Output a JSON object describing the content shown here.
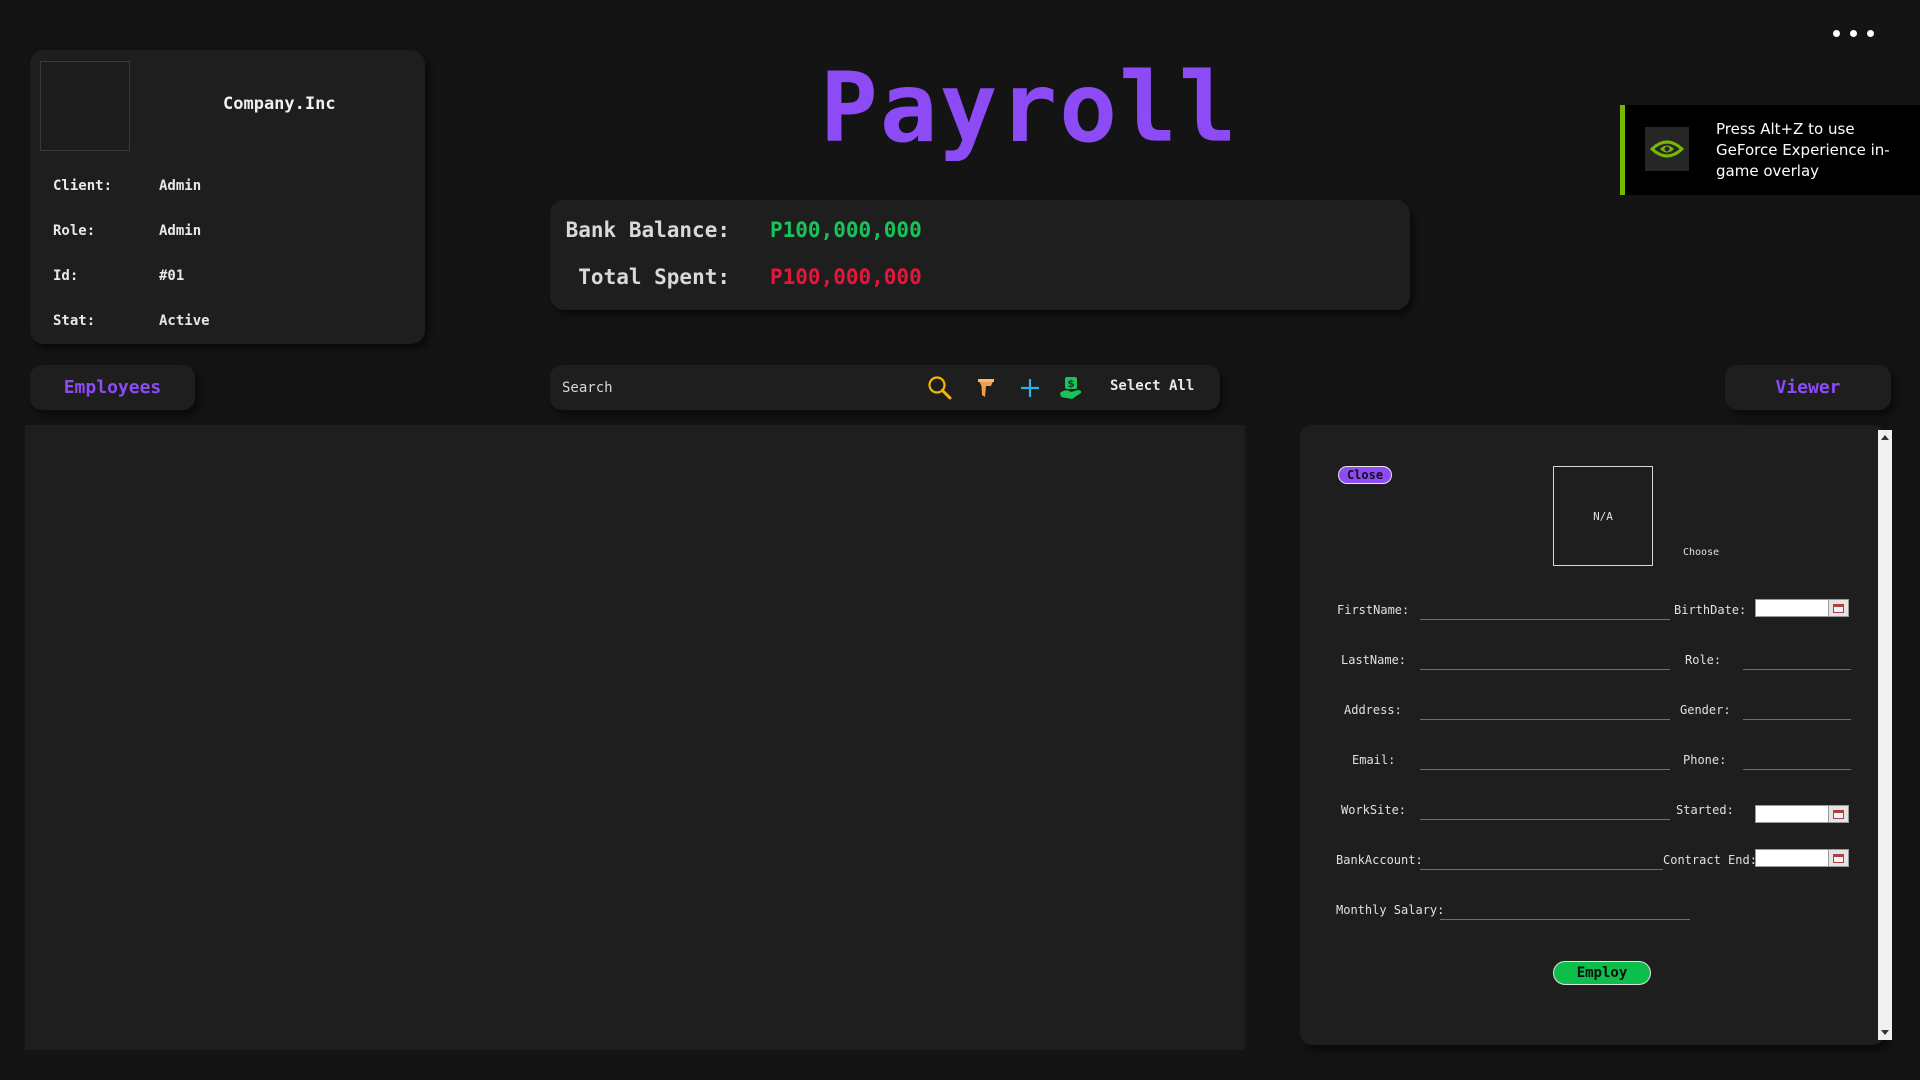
{
  "app": {
    "title": "Payroll"
  },
  "company": {
    "name": "Company.Inc",
    "rows": [
      {
        "label": "Client:",
        "value": "Admin"
      },
      {
        "label": "Role:",
        "value": "Admin"
      },
      {
        "label": "Id:",
        "value": "#01"
      },
      {
        "label": "Stat:",
        "value": "Active"
      }
    ]
  },
  "balance": {
    "bank_label": "Bank Balance:",
    "bank_value": "P100,000,000",
    "spent_label": "Total Spent:",
    "spent_value": "P100,000,000"
  },
  "tabs": {
    "employees": "Employees",
    "viewer": "Viewer"
  },
  "toolbar": {
    "search_placeholder": "Search",
    "select_all": "Select All",
    "icons": [
      "search-icon",
      "filter-icon",
      "add-icon",
      "payment-icon"
    ]
  },
  "viewer": {
    "close": "Close",
    "photo_placeholder": "N/A",
    "choose": "Choose",
    "fields": {
      "firstname": "FirstName:",
      "lastname": "LastName:",
      "address": "Address:",
      "email": "Email:",
      "worksite": "WorkSite:",
      "bankaccount": "BankAccount:",
      "monthly_salary": "Monthly Salary:",
      "birthdate": "BirthDate:",
      "role": "Role:",
      "gender": "Gender:",
      "phone": "Phone:",
      "started": "Started:",
      "contract_end": "Contract End:"
    },
    "employ": "Employ"
  },
  "overlay": {
    "text": "Press Alt+Z to use GeForce Experience in-game overlay"
  },
  "colors": {
    "accent": "#8d4bf5",
    "positive": "#19c25a",
    "negative": "#e4163e",
    "nvidia": "#76b900"
  }
}
